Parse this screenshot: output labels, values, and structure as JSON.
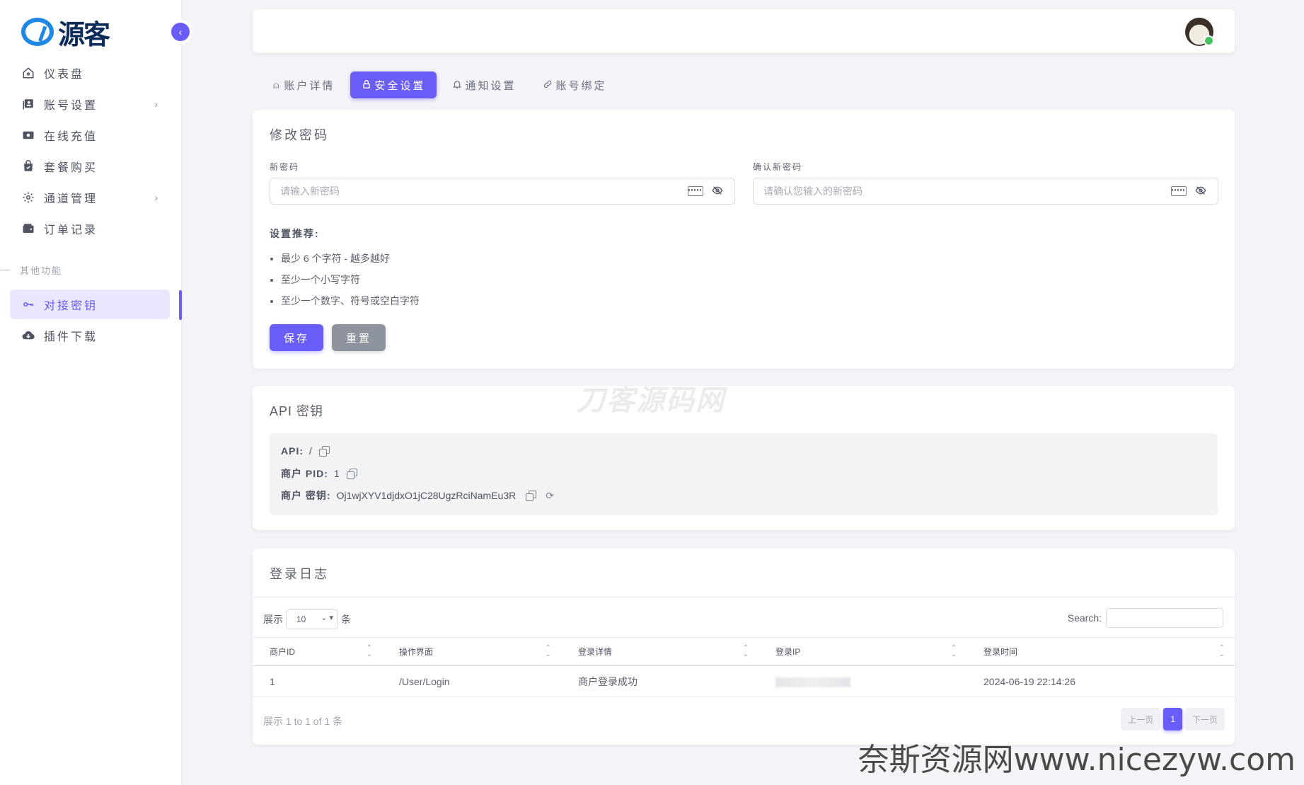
{
  "brand": {
    "logo_text": "源客"
  },
  "sidebar": {
    "items": [
      {
        "label": "仪表盘",
        "icon": "home-icon"
      },
      {
        "label": "账号设置",
        "icon": "id-card-icon",
        "has_children": true
      },
      {
        "label": "在线充值",
        "icon": "cash-icon"
      },
      {
        "label": "套餐购买",
        "icon": "shopping-bag-icon"
      },
      {
        "label": "通道管理",
        "icon": "gear-icon",
        "has_children": true
      },
      {
        "label": "订单记录",
        "icon": "wallet-icon"
      }
    ],
    "section_label": "其他功能",
    "other_items": [
      {
        "label": "对接密钥",
        "icon": "key-icon",
        "active": true
      },
      {
        "label": "插件下载",
        "icon": "cloud-download-icon"
      }
    ]
  },
  "tabs": [
    {
      "label": "账户详情",
      "icon": "user-icon"
    },
    {
      "label": "安全设置",
      "icon": "lock-icon",
      "active": true
    },
    {
      "label": "通知设置",
      "icon": "bell-icon"
    },
    {
      "label": "账号绑定",
      "icon": "link-icon"
    }
  ],
  "password_card": {
    "title": "修改密码",
    "new_password_label": "新密码",
    "new_password_placeholder": "请输入新密码",
    "confirm_label": "确认新密码",
    "confirm_placeholder": "请确认您输入的新密码",
    "recommend_title": "设置推荐:",
    "recommendations": [
      "最少 6 个字符 - 越多越好",
      "至少一个小写字符",
      "至少一个数字、符号或空白字符"
    ],
    "save_label": "保存",
    "reset_label": "重置"
  },
  "watermark": "刀客源码网",
  "api_card": {
    "title": "API 密钥",
    "api_label": "API:",
    "api_value": "/",
    "pid_label": "商户 PID:",
    "pid_value": "1",
    "key_label": "商户 密钥:",
    "key_value": "Oj1wjXYV1djdxO1jC28UgzRciNamEu3R"
  },
  "log_card": {
    "title": "登录日志",
    "length_prefix": "展示",
    "length_value": "10",
    "length_suffix": "条",
    "search_label": "Search:",
    "columns": [
      "商户ID",
      "操作界面",
      "登录详情",
      "登录IP",
      "登录时间"
    ],
    "rows": [
      {
        "id": "1",
        "page": "/User/Login",
        "detail": "商户登录成功",
        "ip": "",
        "time": "2024-06-19 22:14:26"
      }
    ],
    "info": "展示 1 to 1 of 1 条",
    "prev_label": "上一页",
    "current_page": "1",
    "next_label": "下一页"
  },
  "footer_watermark": "奈斯资源网www.nicezyw.com",
  "colors": {
    "accent": "#6a5cf6",
    "secondary_button": "#8d949e",
    "online": "#46c35f"
  }
}
